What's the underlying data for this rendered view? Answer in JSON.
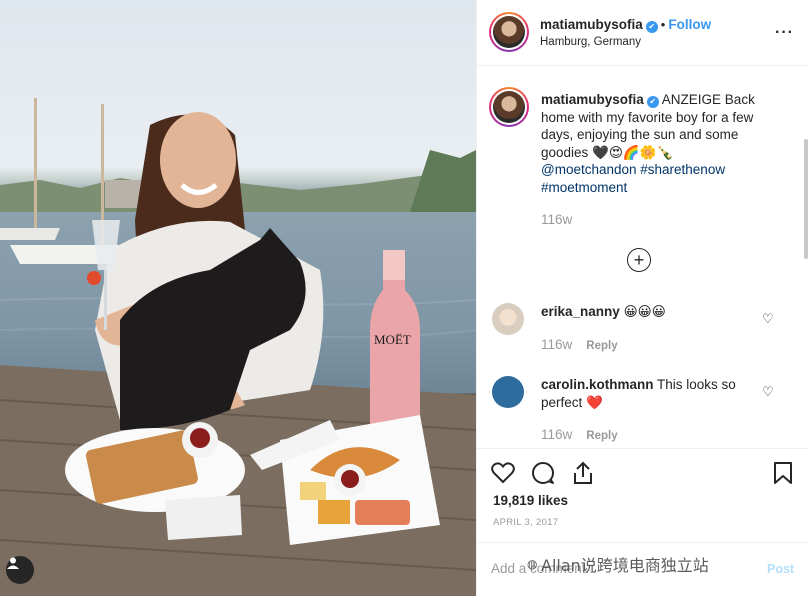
{
  "header": {
    "username": "matiamubysofia",
    "verified": "✔",
    "separator": "•",
    "follow_label": "Follow",
    "location": "Hamburg, Germany",
    "more": "···"
  },
  "caption": {
    "username": "matiamubysofia",
    "text": "ANZEIGE Back home with my favorite boy for a few days, enjoying the sun and some goodies 🖤😍🌈🌼🍾",
    "hashtags": "@moetchandon #sharethenow #moetmoment",
    "time": "116w"
  },
  "load_more": "+",
  "comments": [
    {
      "username": "erika_nanny",
      "text": "😀😀😀",
      "time": "116w",
      "reply_label": "Reply"
    },
    {
      "username": "carolin.kothmann",
      "text": "This looks so perfect ❤️",
      "time": "116w",
      "reply_label": "Reply"
    }
  ],
  "likes_text": "19,819 likes",
  "date_text": "April 3, 2017",
  "add_comment_placeholder": "Add a comment...",
  "post_label": "Post",
  "watermark_text": "Allan说跨境电商独立站",
  "photo_bottle_label": "MOËT",
  "colors": {
    "accent": "#3897f0",
    "hashtag": "#003569",
    "muted": "#999999",
    "carolin_avatar": "#2f6c9e"
  }
}
